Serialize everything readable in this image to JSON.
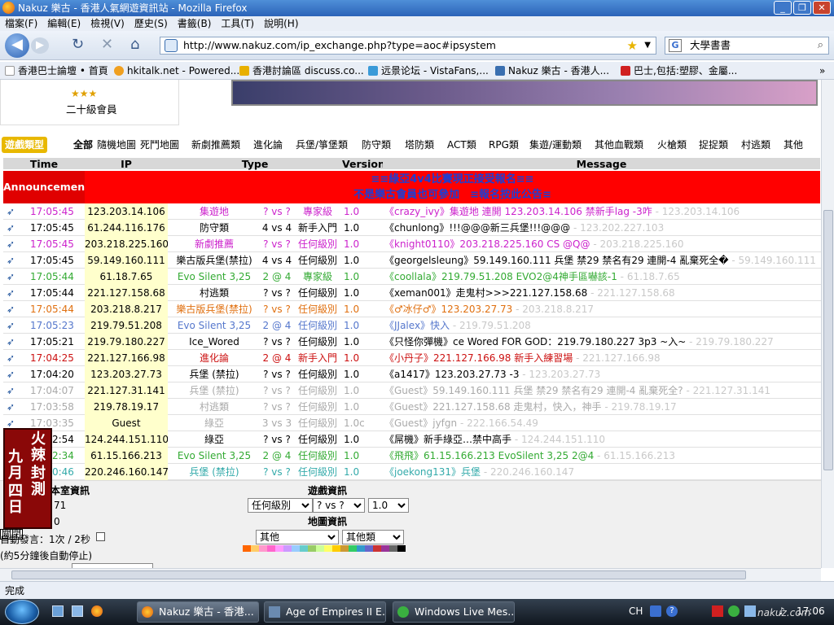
{
  "window": {
    "title": "Nakuz 樂古 - 香港人氣網遊資訊站 - Mozilla Firefox"
  },
  "menu": [
    "檔案(F)",
    "編輯(E)",
    "檢視(V)",
    "歷史(S)",
    "書籤(B)",
    "工具(T)",
    "說明(H)"
  ],
  "nav": {
    "url": "http://www.nakuz.com/ip_exchange.php?type=aoc#ipsystem",
    "search": "大學書書"
  },
  "bookmarks": [
    "香港巴士論壇 • 首頁",
    "hkitalk.net - Powered...",
    "香港討論區 discuss.co...",
    "远景论坛 - VistaFans,...",
    "Nakuz 樂古 - 香港人...",
    "巴士,包括:塑膠、金屬..."
  ],
  "profile": {
    "stars": "★★★",
    "rank": "二十級會員"
  },
  "game_types": {
    "label": "遊戲類型",
    "items": [
      "全部",
      "隨機地圖",
      "死鬥地圖",
      "新劇推薦類",
      "進化論",
      "兵堡/箏堡類",
      "防守類",
      "塔防類",
      "ACT類",
      "RPG類",
      "集遊/運動類",
      "其他血戰類",
      "火槍類",
      "捉捉類",
      "村逃類",
      "其他"
    ]
  },
  "table": {
    "headers": [
      "Time",
      "IP",
      "Type",
      "Version",
      "Message"
    ],
    "announcement_label": "Announcement",
    "announcement_lines": [
      "≡≡綠亞4v4比賽現正接受報名≡≡",
      "不是樂古會員也可參加　≡報名按此公告≡"
    ],
    "rows": [
      {
        "time": "17:05:45",
        "ip": "123.203.14.106",
        "map": "集遊地",
        "players": "? vs ?",
        "level": "專家級",
        "ver": "1.0",
        "msg": "《crazy_ivy》集遊地 連開 123.203.14.106 禁新手lag -3咋",
        "trail": "- 123.203.14.106",
        "color": "#cc22cc",
        "bg": "#fff"
      },
      {
        "time": "17:05:45",
        "ip": "61.244.116.176",
        "map": "防守類",
        "players": "4 vs 4",
        "level": "新手入門",
        "ver": "1.0",
        "msg": "《chunlong》!!!@@@新三兵堡!!!@@@",
        "trail": "- 123.202.227.103",
        "color": "#000000",
        "bg": "#fff"
      },
      {
        "time": "17:05:45",
        "ip": "203.218.225.160",
        "map": "新劇推薦",
        "players": "? vs ?",
        "level": "任何級別",
        "ver": "1.0",
        "msg": "《knight0110》203.218.225.160 CS @Q@",
        "trail": "- 203.218.225.160",
        "color": "#cc22cc",
        "bg": "#fff"
      },
      {
        "time": "17:05:45",
        "ip": "59.149.160.111",
        "map": "樂古版兵堡(禁拉)",
        "players": "4 vs 4",
        "level": "任何級別",
        "ver": "1.0",
        "msg": "《georgelsleung》59.149.160.111 兵堡 禁29 禁名有29 連開-4 亂棄死全�",
        "trail": "- 59.149.160.111",
        "color": "#000000",
        "bg": "#fff"
      },
      {
        "time": "17:05:44",
        "ip": "61.18.7.65",
        "map": "Evo Silent 3,25",
        "players": "2 @ 4",
        "level": "專家級",
        "ver": "1.0",
        "msg": "《coollala》219.79.51.208 EVO2@4神手區嚇該-1",
        "trail": "- 61.18.7.65",
        "color": "#33aa33",
        "bg": "#fff"
      },
      {
        "time": "17:05:44",
        "ip": "221.127.158.68",
        "map": "村逃類",
        "players": "? vs ?",
        "level": "任何級別",
        "ver": "1.0",
        "msg": "《xeman001》走鬼村>>>221.127.158.68",
        "trail": "- 221.127.158.68",
        "color": "#000000",
        "bg": "#fff"
      },
      {
        "time": "17:05:44",
        "ip": "203.218.8.217",
        "map": "樂古版兵堡(禁拉)",
        "players": "? vs ?",
        "level": "任何級別",
        "ver": "1.0",
        "msg": "《♂冰仔♂》123.203.27.73",
        "trail": "- 203.218.8.217",
        "color": "#e07010",
        "bg": "#fff"
      },
      {
        "time": "17:05:23",
        "ip": "219.79.51.208",
        "map": "Evo Silent 3,25",
        "players": "2 @ 4",
        "level": "任何級別",
        "ver": "1.0",
        "msg": "《JJalex》快入",
        "trail": "- 219.79.51.208",
        "color": "#5577cc",
        "bg": "#fff"
      },
      {
        "time": "17:05:21",
        "ip": "219.79.180.227",
        "map": "Ice_Wored",
        "players": "? vs ?",
        "level": "任何級別",
        "ver": "1.0",
        "msg": "《只怪你彈機》ce Wored FOR GOD：219.79.180.227 3p3 ~入~",
        "trail": "- 219.79.180.227",
        "color": "#000000",
        "bg": "#fff"
      },
      {
        "time": "17:04:25",
        "ip": "221.127.166.98",
        "map": "進化論",
        "players": "2 @ 4",
        "level": "新手入門",
        "ver": "1.0",
        "msg": "《小丹子》221.127.166.98 新手入練習場",
        "trail": "- 221.127.166.98",
        "color": "#cc1111",
        "bg": "#fff"
      },
      {
        "time": "17:04:20",
        "ip": "123.203.27.73",
        "map": "兵堡 (禁拉)",
        "players": "? vs ?",
        "level": "任何級別",
        "ver": "1.0",
        "msg": "《a1417》123.203.27.73 -3",
        "trail": "- 123.203.27.73",
        "color": "#000000",
        "bg": "#fff"
      },
      {
        "time": "17:04:07",
        "ip": "221.127.31.141",
        "map": "兵堡 (禁拉)",
        "players": "? vs ?",
        "level": "任何級別",
        "ver": "1.0",
        "msg": "《Guest》59.149.160.111 兵堡 禁29 禁名有29 連開-4 亂棄死全?",
        "trail": "- 221.127.31.141",
        "color": "#aaaaaa",
        "bg": "#fff"
      },
      {
        "time": "17:03:58",
        "ip": "219.78.19.17",
        "map": "村逃類",
        "players": "? vs ?",
        "level": "任何級別",
        "ver": "1.0",
        "msg": "《Guest》221.127.158.68 走鬼村，快入，神手",
        "trail": "- 219.78.19.17",
        "color": "#aaaaaa",
        "bg": "#fff"
      },
      {
        "time": "17:03:35",
        "ip": "Guest",
        "map": "綠亞",
        "players": "3 vs 3",
        "level": "任何級別",
        "ver": "1.0c",
        "msg": "《Guest》jyfgn",
        "trail": "- 222.166.54.49",
        "color": "#aaaaaa",
        "bg": "#fff"
      },
      {
        "time": "17:02:54",
        "ip": "124.244.151.110",
        "map": "綠亞",
        "players": "? vs ?",
        "level": "任何級別",
        "ver": "1.0",
        "msg": "《屌機》新手綠亞…禁中高手",
        "trail": "- 124.244.151.110",
        "color": "#000000",
        "bg": "#fff"
      },
      {
        "time": "17:02:34",
        "ip": "61.15.166.213",
        "map": "Evo Silent 3,25",
        "players": "2 @ 4",
        "level": "任何級別",
        "ver": "1.0",
        "msg": "《飛飛》61.15.166.213 EvoSilent 3,25 2@4",
        "trail": "- 61.15.166.213",
        "color": "#33aa33",
        "bg": "#fff"
      },
      {
        "time": "17:00:46",
        "ip": "220.246.160.147",
        "map": "兵堡 (禁拉)",
        "players": "? vs ?",
        "level": "任何級別",
        "ver": "1.0",
        "msg": "《joekong131》兵堡",
        "trail": "- 220.246.160.147",
        "color": "#33aaaa",
        "bg": "#fff"
      }
    ]
  },
  "bottom": {
    "room_info": "本室資訊",
    "game_info": "遊戲資訊",
    "map_info": "地圖資訊",
    "room_count1": "71",
    "room_count2": "0",
    "auto_refresh": "自動發言：1次 / 2秒",
    "auto_stop": "(約5分鐘後自動停止)",
    "lock_label": "關閉",
    "level_select": "任何級別",
    "vs_select": "? vs ?",
    "ver_select": "1.0",
    "map_select1": "其他",
    "map_select2": "其他類",
    "banner_lines": [
      "火辣",
      "九月",
      "封測",
      "四日"
    ]
  },
  "status": {
    "text": "完成"
  },
  "taskbar": {
    "tasks": [
      "Nakuz 樂古 - 香港...",
      "Age of Empires II E...",
      "Windows Live Mes..."
    ],
    "lang": "CH",
    "clock": "17:06",
    "watermark": "nakuz.com"
  },
  "palette": [
    "#ff6600",
    "#ffcc66",
    "#ff99cc",
    "#ff66cc",
    "#ff99ff",
    "#cc99ff",
    "#99ccff",
    "#66cccc",
    "#99cc66",
    "#ccff99",
    "#ffff66",
    "#ffcc00",
    "#cc9933",
    "#33cc66",
    "#3399cc",
    "#6666cc",
    "#cc3333",
    "#993399",
    "#666666",
    "#000000"
  ]
}
